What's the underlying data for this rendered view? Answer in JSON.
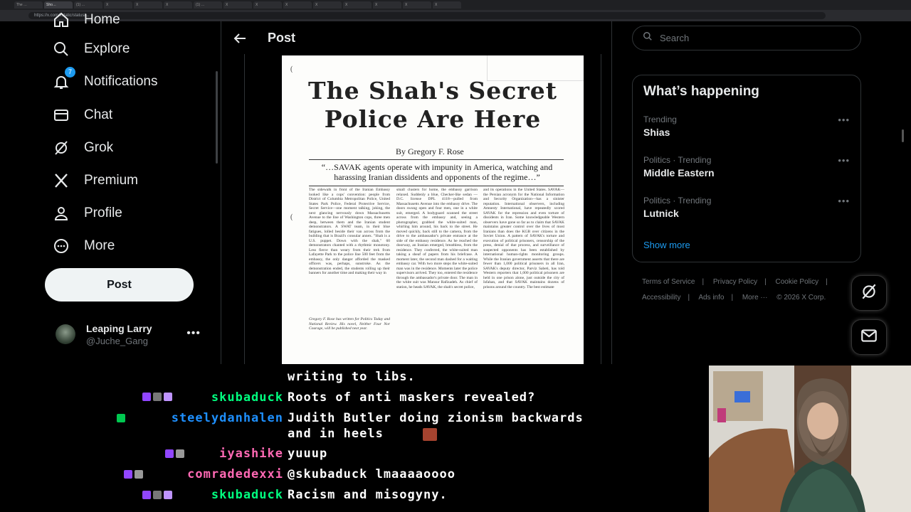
{
  "browser": {
    "tabs": [
      "The …",
      "Sho…",
      "(1) …",
      "X",
      "X",
      "X",
      "(1) …",
      "X",
      "X",
      "X",
      "X",
      "X",
      "X",
      "X",
      "X"
    ],
    "url": "https://x.com/xstatic/status/..."
  },
  "sidebar": {
    "items": [
      {
        "label": "Home",
        "icon": "home-icon"
      },
      {
        "label": "Explore",
        "icon": "search-icon"
      },
      {
        "label": "Notifications",
        "icon": "bell-icon",
        "badge": "7"
      },
      {
        "label": "Chat",
        "icon": "mail-icon"
      },
      {
        "label": "Grok",
        "icon": "grok-icon"
      },
      {
        "label": "Premium",
        "icon": "x-logo-icon"
      },
      {
        "label": "Profile",
        "icon": "person-icon"
      },
      {
        "label": "More",
        "icon": "more-circle-icon"
      }
    ],
    "post_label": "Post",
    "account": {
      "name": "Leaping Larry",
      "handle": "@Juche_Gang"
    }
  },
  "main": {
    "title": "Post",
    "clipping": {
      "headline_line1": "The Shah's Secret",
      "headline_line2": "Police Are Here",
      "byline": "By Gregory F. Rose",
      "quote": "“…SAVAK agents operate with impunity in America, watching and harassing Iranian dissidents and opponents of the regime…”",
      "col1": "The sidewalk in front of the Iranian Embassy looked like a cops' convention: people from District of Columbia Metropolitan Police, United States Park Police, Federal Protective Service, Secret Service—one moment talking, joking, the next glancing nervously down Massachusetts Avenue to the line of Washington cops, three men deep, between them and the Iranian student demonstrators. A SWAT team, in their blue fatigues, lolled beside their van across from the building that is Brazil's consular annex. \"Shah is a U.S. puppet. Down with the shah,\" 60 demonstrators chanted with a rhythmic monotony. Less fierce than weary from their trek from Lafayette Park to the police line 500 feet from the embassy, the only danger afforded the masked officers was, perhaps, sunstroke. As the demonstration ended, the students rolling up their banners for another time and making their way in",
      "col2": "small clusters for home, the embassy garrison relaxed. Suddenly a blue, Checker-like sedan —D.C. license DPL 4118—pulled from Massachusetts Avenue into the embassy drive. The doors swung open and four men, one in a white suit, emerged. A bodyguard scanned the street across from the embassy and, seeing a photographer, grabbed the white-suited man, whirling him around, his back to the street. He moved quickly, back still to the camera, from the drive to the ambassador's private entrance at the side of the embassy residence. As he reached the doorway, an Iranian emerged, breathless, from the residence. They conferred, the white-suited man taking a sheaf of papers from his briefcase. A moment later, the second man dashed for a waiting embassy car. With two more steps the white-suited man was in the residence. Moments later the police supervisors arrived. They too, entered the residence through the ambassador's private door. The man in the white suit was Mansur Rafizadeh. As chief of station, he heads SAVAK, the shah's secret police,",
      "col3": "and its operations in the United States. SAVAK—the Persian acronym for the National Information and Security Organization—has a sinister reputation. International observers, including Amnesty International, have repeatedly scored SAVAK for the repression and even torture of dissidents in Iran. Some knowledgeable Western observers have gone so far as to claim that SAVAK maintains greater control over the lives of most Iranians than does the KGB over citizens in the Soviet Union. A pattern of SAVAK's torture and execution of political prisoners, censorship of the press, denial of due process, and surveillance of suspected opponents has been established by international human-rights monitoring groups. While the Iranian government asserts that there are fewer than 1,000 political prisoners in all Iran, SAVAK's deputy director, Parviz Sabeti, has told Western reporters that 1,000 political prisoners are held in one prison alone, just outside the city of Isfahan, and that SAVAK maintains dozens of prisons around the country. The best estimate",
      "bio": "Gregory F. Rose has written for Politics Today and National Review. His novel, Neither Four Nor Courage, will be published next year."
    }
  },
  "right": {
    "search_placeholder": "Search",
    "card_title": "What’s happening",
    "trends": [
      {
        "meta": "Trending",
        "name": "Shias"
      },
      {
        "meta": "Politics · Trending",
        "name": "Middle Eastern"
      },
      {
        "meta": "Politics · Trending",
        "name": "Lutnick"
      }
    ],
    "show_more": "Show more",
    "footer": {
      "row1": [
        "Terms of Service",
        "|",
        "Privacy Policy",
        "|",
        "Cookie Policy",
        "|"
      ],
      "row2": [
        "Accessibility",
        "|",
        "Ads info",
        "|",
        "More ···",
        "© 2026 X Corp."
      ]
    }
  },
  "chat": {
    "messages": [
      {
        "user": "",
        "text": "writing to libs.",
        "color": "#ffffff"
      },
      {
        "user": "skubaduck",
        "text": "Roots of anti maskers revealed?",
        "color": "#00ff7f"
      },
      {
        "user": "steelydanhalen",
        "text": "Judith Butler doing zionism backwards",
        "text2": "and in heels",
        "color": "#1e90ff"
      },
      {
        "user": "iyashike",
        "text": "yuuup",
        "color": "#ff69b4"
      },
      {
        "user": "comradedexxi",
        "text": "@skubaduck lmaaaaoooo",
        "color": "#ff69b4"
      },
      {
        "user": "skubaduck",
        "text": "Racism and misogyny.",
        "color": "#00ff7f"
      }
    ]
  }
}
